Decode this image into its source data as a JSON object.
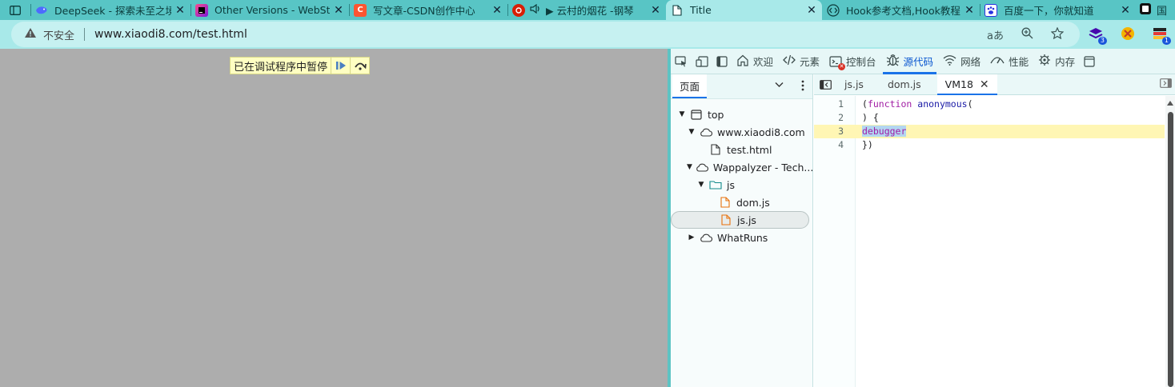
{
  "tabs": [
    {
      "title": "DeepSeek - 探索未至之境",
      "icon": "deepseek-icon",
      "color": "#4d6bfe"
    },
    {
      "title": "Other Versions - WebStorm",
      "icon": "webstorm-icon",
      "color": "#9a1e6b"
    },
    {
      "title": "写文章-CSDN创作中心",
      "icon": "csdn-icon",
      "color": "#fc5531"
    },
    {
      "title": "▶ 云村的烟花 -钢琴",
      "icon": "netease-music-icon",
      "color": "#d81e06"
    },
    {
      "title": "Title",
      "icon": "document-icon",
      "color": "#ffffff"
    },
    {
      "title": "Hook参考文档,Hook教程",
      "icon": "code-icon",
      "color": "#333333"
    },
    {
      "title": "百度一下，你就知道",
      "icon": "baidu-icon",
      "color": "#2932e1"
    }
  ],
  "address": {
    "insecure_label": "不安全",
    "url": "www.xiaodi8.com/test.html"
  },
  "extensions": [
    {
      "icon": "wappalyzer-icon",
      "badge": "3"
    },
    {
      "icon": "whatruns-icon",
      "badge": ""
    },
    {
      "icon": "ext-stripes-icon",
      "badge": "1"
    }
  ],
  "page": {
    "paused_message": "已在调试程序中暂停"
  },
  "devtools": {
    "toolbar": [
      {
        "label": "欢迎",
        "icon": "home-icon"
      },
      {
        "label": "元素",
        "icon": "elements-icon"
      },
      {
        "label": "控制台",
        "icon": "console-icon"
      },
      {
        "label": "源代码",
        "icon": "bug-icon",
        "active": true
      },
      {
        "label": "网络",
        "icon": "wifi-icon"
      },
      {
        "label": "性能",
        "icon": "performance-icon"
      },
      {
        "label": "内存",
        "icon": "memory-icon"
      }
    ],
    "navigator": {
      "tab_label": "页面",
      "tree": [
        {
          "label": "top",
          "depth": 0,
          "arrow": "down",
          "icon": "frame-icon"
        },
        {
          "label": "www.xiaodi8.com",
          "depth": 1,
          "arrow": "down",
          "icon": "cloud-icon"
        },
        {
          "label": "test.html",
          "depth": 2,
          "arrow": "",
          "icon": "file-icon"
        },
        {
          "label": "Wappalyzer - Tech...",
          "depth": 1,
          "arrow": "down",
          "icon": "cloud-icon"
        },
        {
          "label": "js",
          "depth": 2,
          "arrow": "down",
          "icon": "folder-icon"
        },
        {
          "label": "dom.js",
          "depth": 3,
          "arrow": "",
          "icon": "js-file-icon"
        },
        {
          "label": "js.js",
          "depth": 3,
          "arrow": "",
          "icon": "js-file-icon",
          "selected": true
        },
        {
          "label": "WhatRuns",
          "depth": 1,
          "arrow": "right",
          "icon": "cloud-icon"
        }
      ]
    },
    "editor": {
      "tabs": [
        {
          "label": "js.js"
        },
        {
          "label": "dom.js"
        },
        {
          "label": "VM18",
          "active": true,
          "closable": true
        }
      ],
      "lines": [
        {
          "n": "1",
          "text": "(function anonymous("
        },
        {
          "n": "2",
          "text": ") {"
        },
        {
          "n": "3",
          "text": "debugger"
        },
        {
          "n": "4",
          "text": "})"
        }
      ]
    }
  }
}
